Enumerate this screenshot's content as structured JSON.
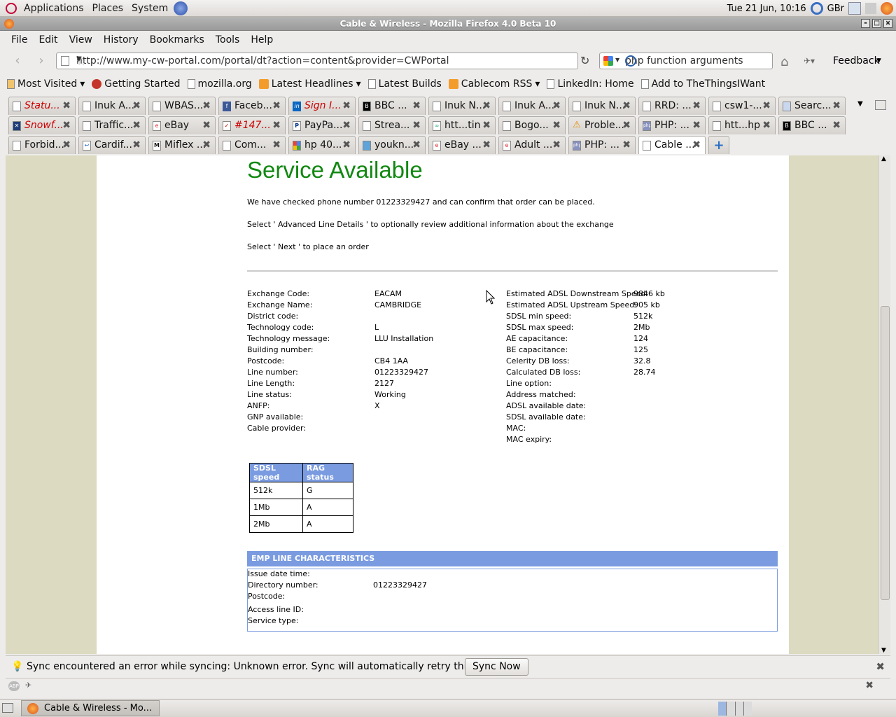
{
  "gnome": {
    "menus": [
      "Applications",
      "Places",
      "System"
    ],
    "clock": "Tue 21 Jun, 10:16",
    "keyboard": "GBr"
  },
  "window": {
    "title": "Cable & Wireless - Mozilla Firefox 4.0 Beta 10"
  },
  "menubar": [
    "File",
    "Edit",
    "View",
    "History",
    "Bookmarks",
    "Tools",
    "Help"
  ],
  "navbar": {
    "url": "http://www.my-cw-portal.com/portal/dt?action=content&provider=CWPortal",
    "search": "php function arguments",
    "feedback": "Feedback"
  },
  "bookmarks": [
    {
      "label": "Most Visited",
      "dropdown": true
    },
    {
      "label": "Getting Started",
      "dropdown": false
    },
    {
      "label": "mozilla.org",
      "dropdown": false
    },
    {
      "label": "Latest Headlines",
      "dropdown": true
    },
    {
      "label": "Latest Builds",
      "dropdown": false
    },
    {
      "label": "Cablecom RSS",
      "dropdown": true
    },
    {
      "label": "LinkedIn: Home",
      "dropdown": false
    },
    {
      "label": "Add to TheThingsIWant",
      "dropdown": false
    }
  ],
  "tabs": {
    "row1": [
      "Statu...",
      "Inuk A...",
      "WBAS...",
      "Faceb...",
      "Sign I...",
      "BBC ...",
      "Inuk N...",
      "Inuk A...",
      "Inuk N...",
      "RRD: ...",
      "csw1-...",
      "Searc..."
    ],
    "row2": [
      "Snowf...",
      "Traffic...",
      "eBay",
      "#147...",
      "PayPa...",
      "Strea...",
      "htt...tin",
      "Bogo...",
      "Proble...",
      "PHP: ...",
      "htt...hp",
      "BBC ..."
    ],
    "row3": [
      "Forbid...",
      "Cardif...",
      "Miflex ...",
      "Com...",
      "hp 40...",
      "youkn...",
      "eBay ...",
      "Adult ...",
      "PHP: ...",
      "Cable ..."
    ]
  },
  "page": {
    "heading": "Service Available",
    "p1": "We have checked phone number 01223329427 and can confirm that order can be placed.",
    "p2": "Select ' Advanced Line Details ' to optionally review additional information about the exchange",
    "p3": "Select ' Next ' to place an order",
    "left_fields": [
      {
        "label": "Exchange Code:",
        "value": "EACAM"
      },
      {
        "label": "Exchange Name:",
        "value": "CAMBRIDGE"
      },
      {
        "label": "District code:",
        "value": ""
      },
      {
        "label": "Technology code:",
        "value": "L"
      },
      {
        "label": "Technology message:",
        "value": "LLU Installation"
      },
      {
        "label": "Building number:",
        "value": ""
      },
      {
        "label": "Postcode:",
        "value": "CB4 1AA"
      },
      {
        "label": "Line number:",
        "value": "01223329427"
      },
      {
        "label": "Line Length:",
        "value": "2127"
      },
      {
        "label": "Line status:",
        "value": "Working"
      },
      {
        "label": "ANFP:",
        "value": "X"
      },
      {
        "label": "GNP available:",
        "value": ""
      },
      {
        "label": "Cable provider:",
        "value": ""
      }
    ],
    "right_fields": [
      {
        "label": "Estimated ADSL Downstream Speed:",
        "value": "9846 kb"
      },
      {
        "label": "Estimated ADSL Upstream Speed:",
        "value": "905 kb"
      },
      {
        "label": "SDSL min speed:",
        "value": "512k"
      },
      {
        "label": "SDSL max speed:",
        "value": "2Mb"
      },
      {
        "label": "AE capacitance:",
        "value": "124"
      },
      {
        "label": "BE capacitance:",
        "value": "125"
      },
      {
        "label": "Celerity DB loss:",
        "value": "32.8"
      },
      {
        "label": "Calculated DB loss:",
        "value": "28.74"
      },
      {
        "label": "Line option:",
        "value": ""
      },
      {
        "label": "Address matched:",
        "value": ""
      },
      {
        "label": "ADSL available date:",
        "value": ""
      },
      {
        "label": "SDSL available date:",
        "value": ""
      },
      {
        "label": "MAC:",
        "value": ""
      },
      {
        "label": "MAC expiry:",
        "value": ""
      }
    ],
    "rag_table": {
      "headers": [
        "SDSL speed",
        "RAG status"
      ],
      "rows": [
        [
          "512k",
          "G"
        ],
        [
          "1Mb",
          "A"
        ],
        [
          "2Mb",
          "A"
        ]
      ]
    },
    "emp": {
      "title": "EMP LINE CHARACTERISTICS",
      "fields": [
        {
          "label": "Issue date time:",
          "value": ""
        },
        {
          "label": "Directory number:",
          "value": "01223329427"
        },
        {
          "label": "Postcode:",
          "value": ""
        },
        {
          "label": "Access line ID:",
          "value": ""
        },
        {
          "label": "Service type:",
          "value": ""
        }
      ]
    }
  },
  "notification": {
    "text": "Sync encountered an error while syncing: Unknown error. Sync will automatically retry this action.",
    "button": "Sync Now"
  },
  "taskbar": {
    "item": "Cable & Wireless - Mo..."
  }
}
